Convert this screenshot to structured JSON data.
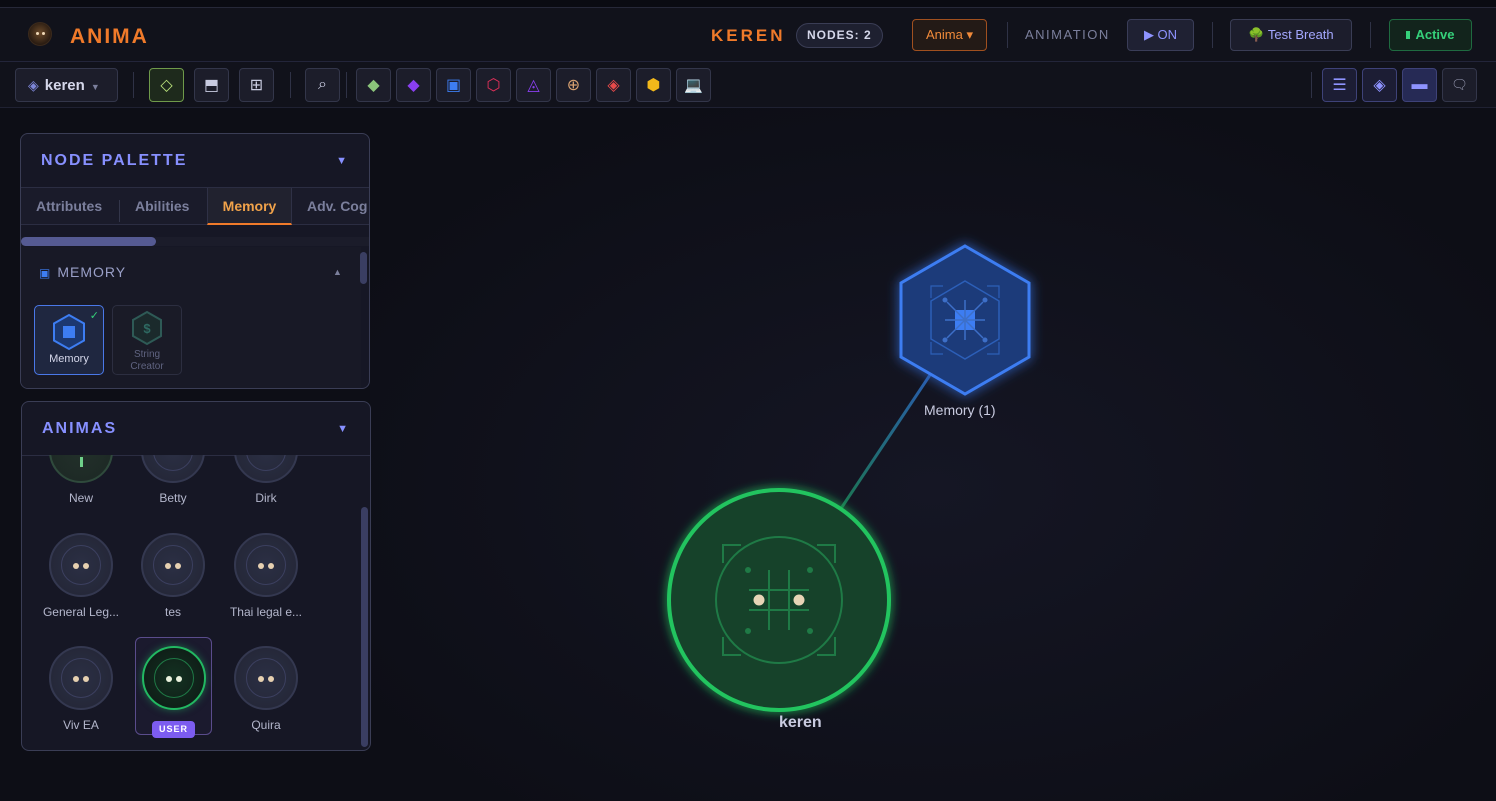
{
  "header": {
    "app_name": "ANIMA",
    "workspace_name": "KEREN",
    "nodes_badge": "NODES: 2",
    "anima_dropdown": "Anima ▾",
    "animation_label": "ANIMATION",
    "animation_toggle": "▶ ON",
    "test_breath_button": "🌳 Test Breath",
    "active_button": "Active"
  },
  "toolbar": {
    "workspace_select": "keren",
    "tools": [
      {
        "icon": "diamond-outline-icon",
        "glyph": "◇"
      },
      {
        "icon": "layout-icon",
        "glyph": "⬒"
      },
      {
        "icon": "grid-icon",
        "glyph": "⊞"
      },
      {
        "icon": "search-icon",
        "glyph": "⌕"
      }
    ],
    "node_types": [
      {
        "icon": "attribute-node-icon",
        "glyph": "◆",
        "color": "#8bc47a"
      },
      {
        "icon": "ability-node-icon",
        "glyph": "◆",
        "color": "#8a3ff0"
      },
      {
        "icon": "memory-node-icon",
        "glyph": "▣",
        "color": "#3d7df2"
      },
      {
        "icon": "hexagon-node-icon",
        "glyph": "⬡",
        "color": "#e0305a"
      },
      {
        "icon": "triangle-node-icon",
        "glyph": "◬",
        "color": "#8a3ff0"
      },
      {
        "icon": "crosshair-node-icon",
        "glyph": "⊕",
        "color": "#d6a070"
      },
      {
        "icon": "diamond-red-node-icon",
        "glyph": "◈",
        "color": "#e84a4a"
      },
      {
        "icon": "hexagon-gold-node-icon",
        "glyph": "⬢",
        "color": "#f2b81a"
      },
      {
        "icon": "laptop-node-icon",
        "glyph": "💻",
        "color": "#7fc8e8"
      }
    ],
    "right_tools": [
      {
        "icon": "list-icon",
        "glyph": "☰"
      },
      {
        "icon": "diamond-view-icon",
        "glyph": "◈"
      },
      {
        "icon": "panel-icon",
        "glyph": "▬"
      },
      {
        "icon": "chat-icon",
        "glyph": "🗨"
      }
    ]
  },
  "node_palette": {
    "title": "NODE PALETTE",
    "tabs": [
      "Attributes",
      "Abilities",
      "Memory",
      "Adv. Cog"
    ],
    "active_tab": "Memory",
    "section_title": "MEMORY",
    "items": [
      {
        "label": "Memory",
        "selected": true
      },
      {
        "label": "String Creator",
        "selected": false
      }
    ]
  },
  "animas": {
    "title": "ANIMAS",
    "items": [
      "New",
      "Betty",
      "Dirk",
      "General Leg...",
      "tes",
      "Thai legal e...",
      "Viv EA",
      "",
      "Quira"
    ],
    "user_badge": "USER"
  },
  "canvas": {
    "memory_node_label": "Memory (1)",
    "anima_node_label": "keren"
  },
  "colors": {
    "accent_orange": "#f07a2a",
    "accent_purple": "#8790ff",
    "memory_blue": "#3d7df2",
    "active_green": "#35d07a"
  }
}
